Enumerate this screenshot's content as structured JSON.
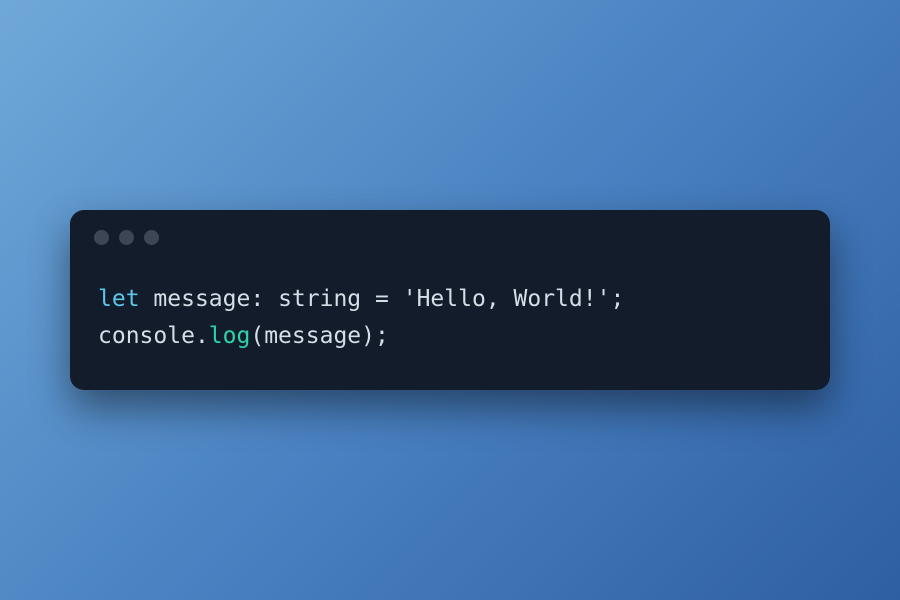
{
  "editor": {
    "titlebar": {
      "dots": [
        "close",
        "minimize",
        "zoom"
      ]
    },
    "code": {
      "line1": {
        "keyword": "let",
        "space1": " ",
        "variable": "message",
        "colon": ":",
        "space2": " ",
        "type": "string",
        "space3": " ",
        "assign": "=",
        "space4": " ",
        "string": "'Hello, World!'",
        "semicolon": ";"
      },
      "line2": {
        "object": "console",
        "dot": ".",
        "method": "log",
        "openParen": "(",
        "arg": "message",
        "closeParen": ")",
        "semicolon": ";"
      }
    }
  },
  "colors": {
    "bg_gradient_start": "#6fa8d8",
    "bg_gradient_end": "#2e5fa3",
    "editor_bg": "#131c2b",
    "dot": "#3d4654",
    "text_default": "#d6dde6",
    "keyword": "#5cc7e8",
    "method": "#2dd4a9"
  }
}
